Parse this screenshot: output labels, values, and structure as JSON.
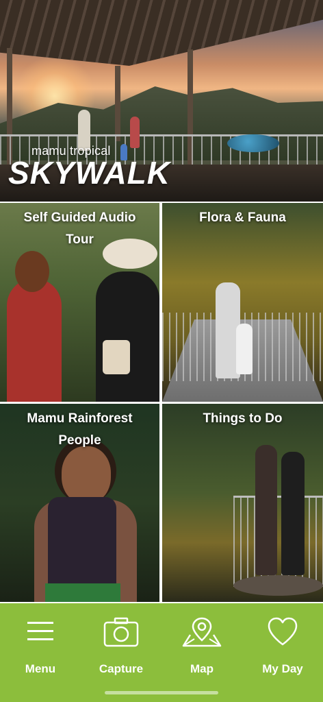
{
  "hero": {
    "logo_small": "mamu tropical",
    "logo_big": "SKYWALK"
  },
  "tiles": [
    {
      "title": "Self Guided Audio Tour"
    },
    {
      "title": "Flora & Fauna"
    },
    {
      "title": "Mamu Rainforest People"
    },
    {
      "title": "Things to Do"
    }
  ],
  "nav": {
    "items": [
      {
        "label": "Menu",
        "icon": "hamburger-icon"
      },
      {
        "label": "Capture",
        "icon": "camera-icon"
      },
      {
        "label": "Map",
        "icon": "map-pin-icon"
      },
      {
        "label": "My Day",
        "icon": "heart-icon"
      }
    ]
  },
  "colors": {
    "nav_bg": "#8cbe3c",
    "text_white": "#ffffff"
  }
}
